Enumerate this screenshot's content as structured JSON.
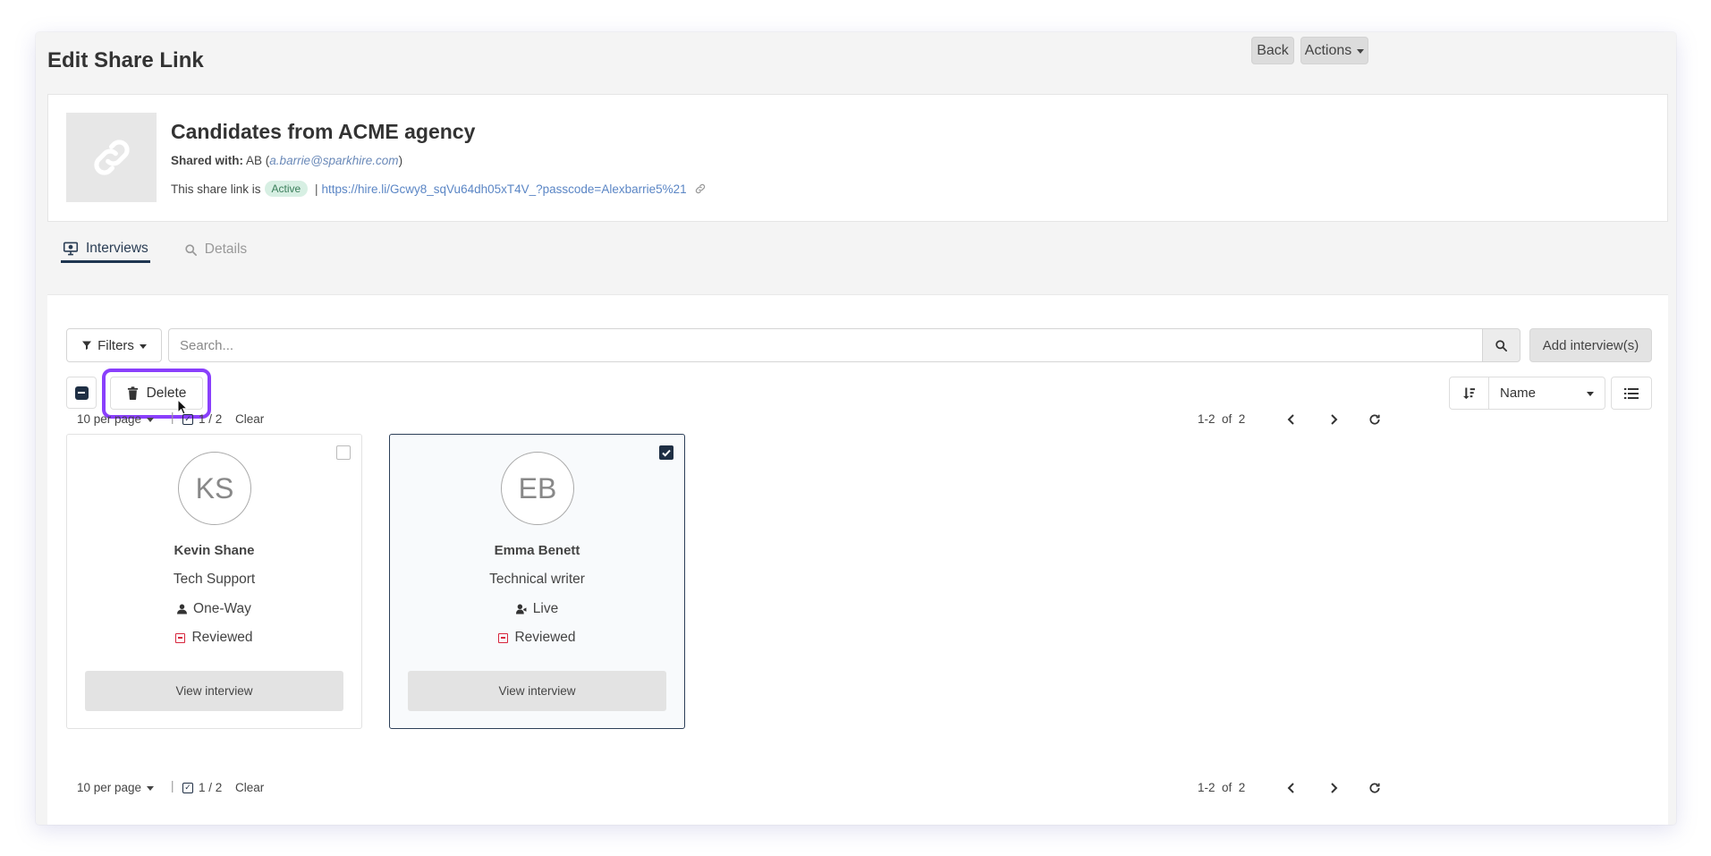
{
  "header": {
    "title": "Edit Share Link",
    "back_label": "Back",
    "actions_label": "Actions"
  },
  "share": {
    "title": "Candidates from ACME agency",
    "shared_with_label": "Shared with:",
    "shared_with_initials": "AB",
    "shared_with_email": "a.barrie@sparkhire.com",
    "status_prefix": "This share link is",
    "status": "Active",
    "url": "https://hire.li/Gcwy8_sqVu64dh05xT4V_?passcode=Alexbarrie5%21"
  },
  "tabs": [
    {
      "label": "Interviews",
      "icon": "monitor-icon",
      "active": true
    },
    {
      "label": "Details",
      "icon": "search-icon",
      "active": false
    }
  ],
  "toolbar": {
    "filters_label": "Filters",
    "search_placeholder": "Search...",
    "add_label": "Add interview(s)",
    "delete_label": "Delete",
    "sort_value": "Name"
  },
  "pager": {
    "per_page": "10 per page",
    "selected": "1 / 2",
    "clear": "Clear",
    "range": "1-2  of  2"
  },
  "candidates": [
    {
      "initials": "KS",
      "name": "Kevin Shane",
      "role": "Tech Support",
      "type": "One-Way",
      "type_icon": "user-icon",
      "status": "Reviewed",
      "selected": false,
      "button": "View interview"
    },
    {
      "initials": "EB",
      "name": "Emma Benett",
      "role": "Technical writer",
      "type": "Live",
      "type_icon": "user-video-icon",
      "status": "Reviewed",
      "selected": true,
      "button": "View interview"
    }
  ],
  "colors": {
    "accent_dark": "#1f2f44",
    "highlight": "#8a3ffc",
    "link": "#5b86c5",
    "active_badge_bg": "#d7efe3",
    "reviewed": "#d7263d"
  }
}
